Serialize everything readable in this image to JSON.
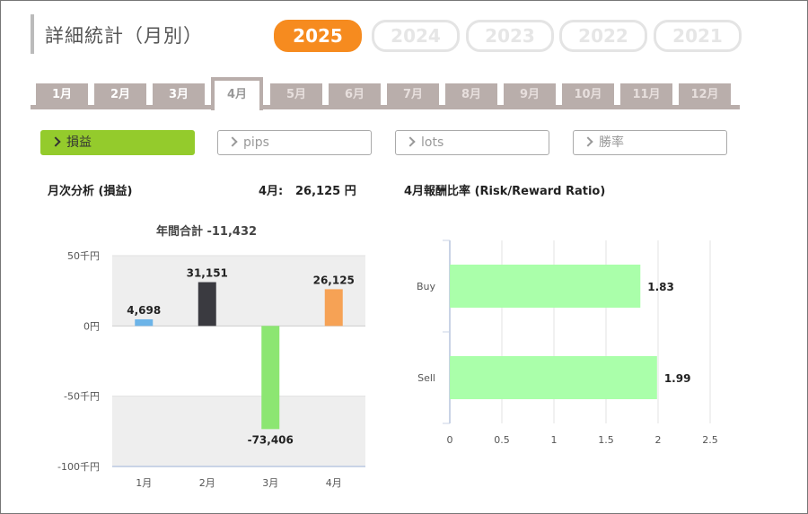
{
  "title": "詳細統計（月別）",
  "years": [
    {
      "label": "2025",
      "active": true
    },
    {
      "label": "2024",
      "active": false
    },
    {
      "label": "2023",
      "active": false
    },
    {
      "label": "2022",
      "active": false
    },
    {
      "label": "2021",
      "active": false
    }
  ],
  "months": [
    "1月",
    "2月",
    "3月",
    "4月",
    "5月",
    "6月",
    "7月",
    "8月",
    "9月",
    "10月",
    "11月",
    "12月"
  ],
  "active_month": "4月",
  "metrics": [
    "損益",
    "pips",
    "lots",
    "勝率"
  ],
  "monthly": {
    "heading": "月次分析 (損益)",
    "month_label": "4月:",
    "month_value": "26,125 円"
  },
  "ratio_heading": "4月報酬比率 (Risk/Reward Ratio)",
  "colors": {
    "accent": "#f68b1f",
    "tab": "#b9aeab",
    "metric_active": "#94cb2c"
  },
  "chart_data": [
    {
      "type": "bar",
      "title": "年間合計 -11,432",
      "categories": [
        "1月",
        "2月",
        "3月",
        "4月"
      ],
      "values": [
        4698,
        31151,
        -73406,
        26125
      ],
      "labels": [
        "4,698",
        "31,151",
        "-73,406",
        "26,125"
      ],
      "colors": [
        "#6cb4e8",
        "#3a3a40",
        "#8ce672",
        "#f6a255"
      ],
      "ylim": [
        -100000,
        50000
      ],
      "yticks": [
        {
          "value": 50000,
          "label": "50千円"
        },
        {
          "value": 0,
          "label": "0円"
        },
        {
          "value": -50000,
          "label": "-50千円"
        },
        {
          "value": -100000,
          "label": "-100千円"
        }
      ]
    },
    {
      "type": "bar",
      "orientation": "horizontal",
      "categories": [
        "Buy",
        "Sell"
      ],
      "values": [
        1.83,
        1.99
      ],
      "labels": [
        "1.83",
        "1.99"
      ],
      "color": "#aaffaa",
      "xlim": [
        0,
        2.5
      ],
      "xticks": [
        "0",
        "0.5",
        "1",
        "1.5",
        "2",
        "2.5"
      ]
    }
  ]
}
